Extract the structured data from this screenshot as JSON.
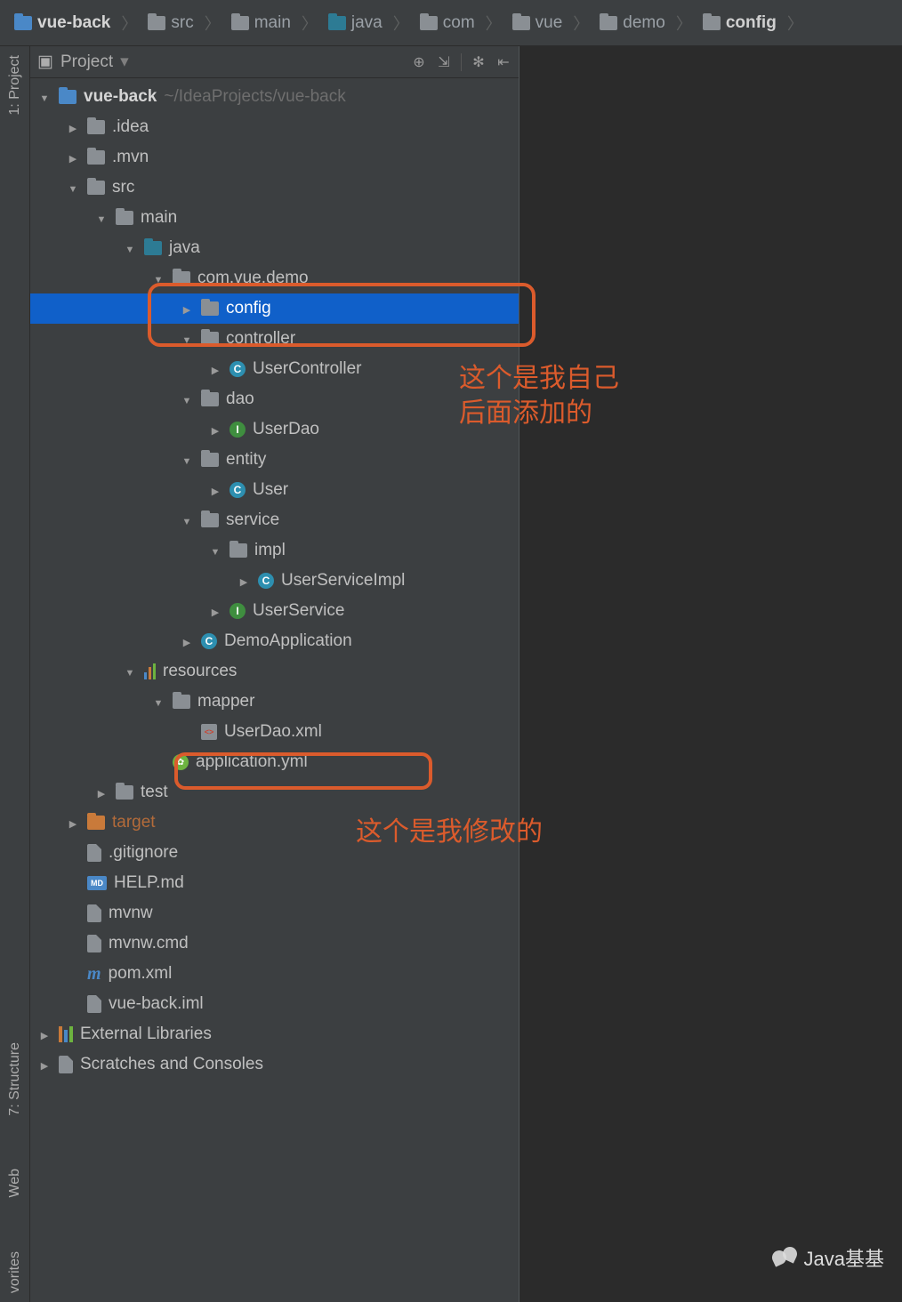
{
  "breadcrumbs": [
    {
      "label": "vue-back",
      "style": "blue",
      "bold": true
    },
    {
      "label": "src",
      "style": "grey"
    },
    {
      "label": "main",
      "style": "grey"
    },
    {
      "label": "java",
      "style": "teal"
    },
    {
      "label": "com",
      "style": "grey"
    },
    {
      "label": "vue",
      "style": "grey"
    },
    {
      "label": "demo",
      "style": "grey"
    },
    {
      "label": "config",
      "style": "grey"
    }
  ],
  "panel": {
    "title": "Project"
  },
  "left_tabs": [
    "1: Project",
    "7: Structure",
    "Web",
    "vorites"
  ],
  "tree": {
    "root": {
      "name": "vue-back",
      "path": "~/IdeaProjects/vue-back"
    },
    "idea": ".idea",
    "mvn": ".mvn",
    "src": "src",
    "main": "main",
    "java": "java",
    "pkg": "com.vue.demo",
    "config": "config",
    "controller": "controller",
    "usercontroller": "UserController",
    "dao": "dao",
    "userdao": "UserDao",
    "entity": "entity",
    "user": "User",
    "service": "service",
    "impl": "impl",
    "userserviceimpl": "UserServiceImpl",
    "userservice": "UserService",
    "demoapp": "DemoApplication",
    "resources": "resources",
    "mapper": "mapper",
    "userdaoxml": "UserDao.xml",
    "appyml": "application.yml",
    "test": "test",
    "target": "target",
    "gitignore": ".gitignore",
    "help": "HELP.md",
    "mvnw": "mvnw",
    "mvnwcmd": "mvnw.cmd",
    "pom": "pom.xml",
    "iml": "vue-back.iml",
    "extlib": "External Libraries",
    "scratches": "Scratches and Consoles"
  },
  "annotations": {
    "a1": "这个是我自己\n后面添加的",
    "a2": "这个是我修改的"
  },
  "watermark": "Java基基"
}
